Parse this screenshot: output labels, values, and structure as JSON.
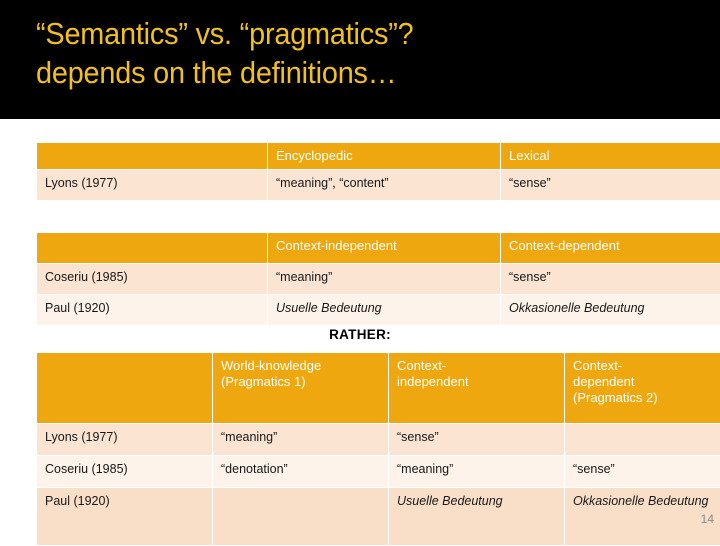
{
  "slide": {
    "title_line1": "“Semantics” vs. “pragmatics”?",
    "title_line2": "depends on the definitions…",
    "rather_label": "RATHER:",
    "page_number": "14",
    "colors": {
      "banner_background": "#000000",
      "title_text": "#F2C01E",
      "table_header": "#EFA70F",
      "header_text": "#FFFFFF",
      "row_shade_a": "#FBE4D2",
      "row_shade_b": "#FDF3EA",
      "row_shade_c": "#FADFC8",
      "page_number_text": "#8A8A8A"
    }
  },
  "table1": {
    "headers": [
      "",
      "Encyclopedic",
      "Lexical"
    ],
    "rows": [
      [
        "Lyons (1977)",
        "“meaning”, “content”",
        "“sense”"
      ]
    ]
  },
  "table2": {
    "headers": [
      "",
      "Context-independent",
      "Context-dependent"
    ],
    "rows": [
      [
        "Coseriu (1985)",
        "“meaning”",
        "“sense”"
      ],
      [
        "Paul (1920)",
        "Usuelle Bedeutung",
        "Okkasionelle Bedeutung"
      ]
    ]
  },
  "table3": {
    "headers": [
      "",
      "World-knowledge (Pragmatics 1)",
      "Context-independent",
      "Context-dependent (Pragmatics 2)"
    ],
    "header_lines": {
      "col1": [
        "World-knowledge",
        "(Pragmatics 1)"
      ],
      "col2": [
        "Context-",
        "independent"
      ],
      "col3": [
        "Context-",
        "dependent",
        "(Pragmatics 2)"
      ]
    },
    "rows": [
      [
        "Lyons (1977)",
        "“meaning”",
        "“sense”",
        ""
      ],
      [
        "Coseriu (1985)",
        "“denotation”",
        "“meaning”",
        "“sense”"
      ],
      [
        "Paul (1920)",
        "",
        "Usuelle Bedeutung",
        "Okkasionelle Bedeutung"
      ]
    ]
  }
}
